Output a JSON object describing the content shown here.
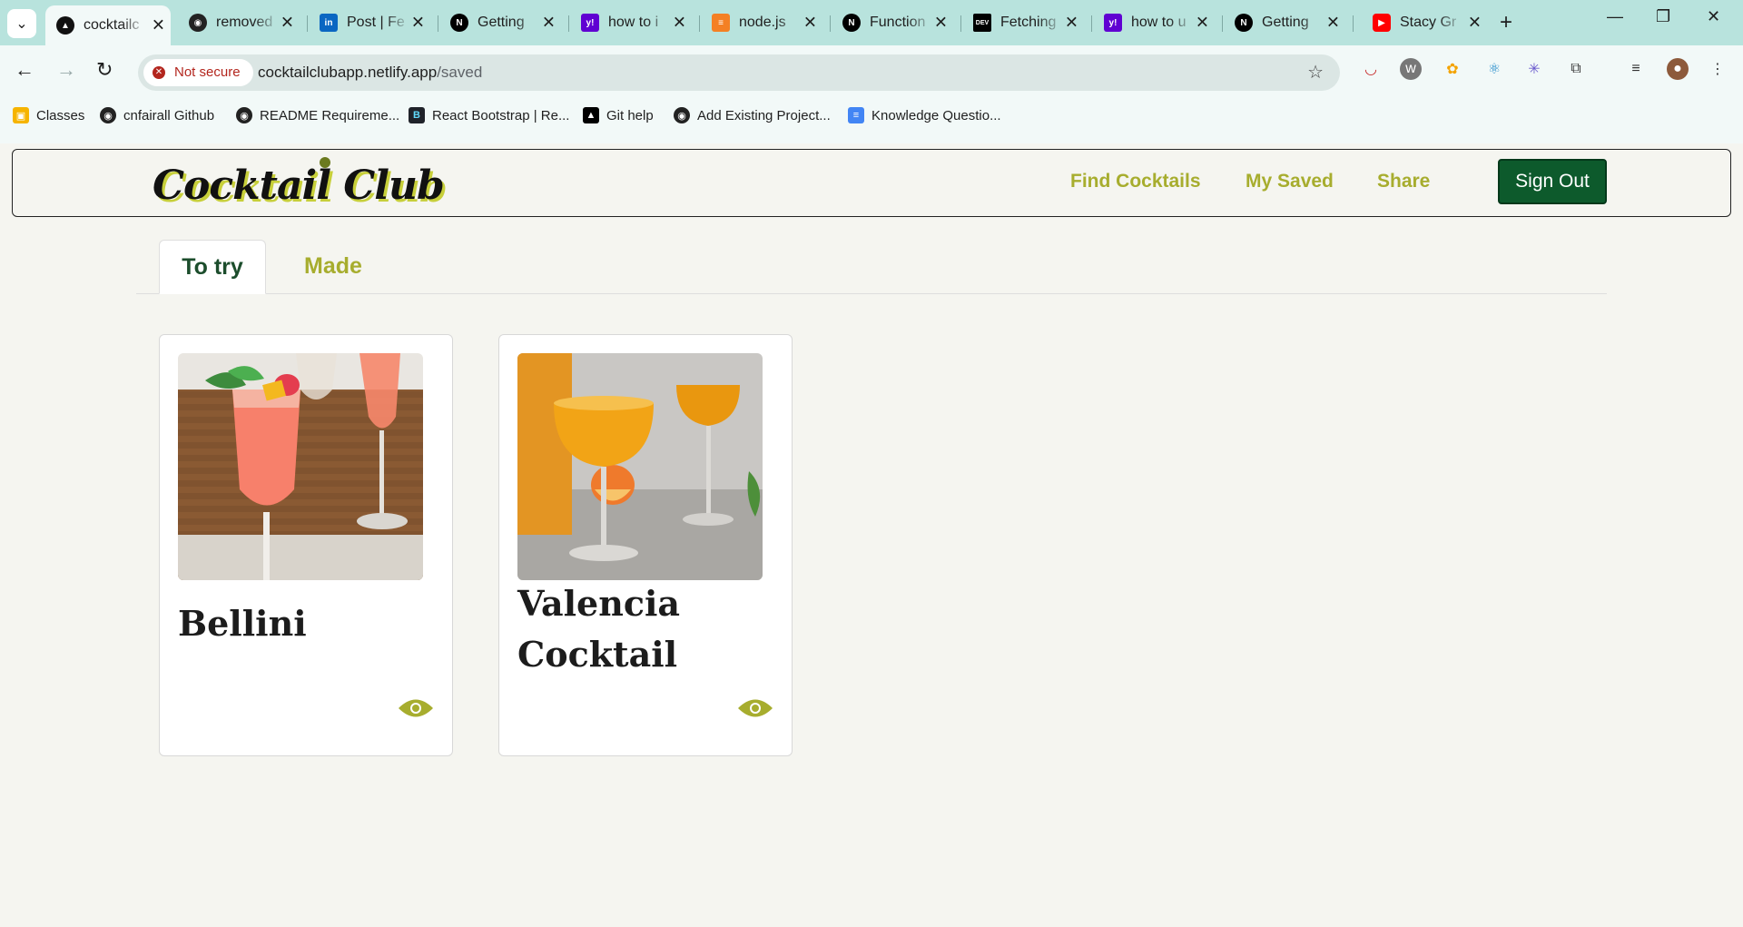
{
  "browser": {
    "tabs": [
      {
        "title": "cocktailc",
        "icon": "netlify-icon",
        "active": true
      },
      {
        "title": "removed",
        "icon": "github-icon"
      },
      {
        "title": "Post | Fe",
        "icon": "linkedin-icon"
      },
      {
        "title": "Getting",
        "icon": "nextjs-icon"
      },
      {
        "title": "how to i",
        "icon": "yahoo-icon"
      },
      {
        "title": "node.js",
        "icon": "stackoverflow-icon"
      },
      {
        "title": "Function",
        "icon": "nextjs-icon"
      },
      {
        "title": "Fetching",
        "icon": "dev-icon"
      },
      {
        "title": "how to u",
        "icon": "yahoo-icon"
      },
      {
        "title": "Getting",
        "icon": "nextjs-icon"
      },
      {
        "title": "Stacy Gr",
        "icon": "youtube-icon"
      }
    ],
    "security_label": "Not secure",
    "url_host": "cocktailclubapp.netlify.app",
    "url_path": "/saved",
    "bookmarks": [
      {
        "label": "Classes",
        "icon": "classroom-icon"
      },
      {
        "label": "cnfairall Github",
        "icon": "github-icon"
      },
      {
        "label": "README Requireme...",
        "icon": "github-icon"
      },
      {
        "label": "React Bootstrap | Re...",
        "icon": "react-bootstrap-icon"
      },
      {
        "label": "Git help",
        "icon": "vercel-icon"
      },
      {
        "label": "Add Existing Project...",
        "icon": "github-icon"
      },
      {
        "label": "Knowledge Questio...",
        "icon": "docs-icon"
      }
    ]
  },
  "site": {
    "logo": "Cocktail Club",
    "nav": {
      "find": "Find Cocktails",
      "saved": "My Saved",
      "share": "Share",
      "signout": "Sign Out"
    },
    "tabs": {
      "to_try": "To try",
      "made": "Made"
    },
    "cards": [
      {
        "name": "Bellini",
        "image": "bellini-photo"
      },
      {
        "name": "Valencia Cocktail",
        "image": "valencia-photo"
      }
    ]
  },
  "colors": {
    "accent": "#a7ad2e",
    "signout_bg": "#0d5a2c",
    "tab_active_text": "#1c4d2c",
    "page_bg": "#f5f5f0"
  }
}
